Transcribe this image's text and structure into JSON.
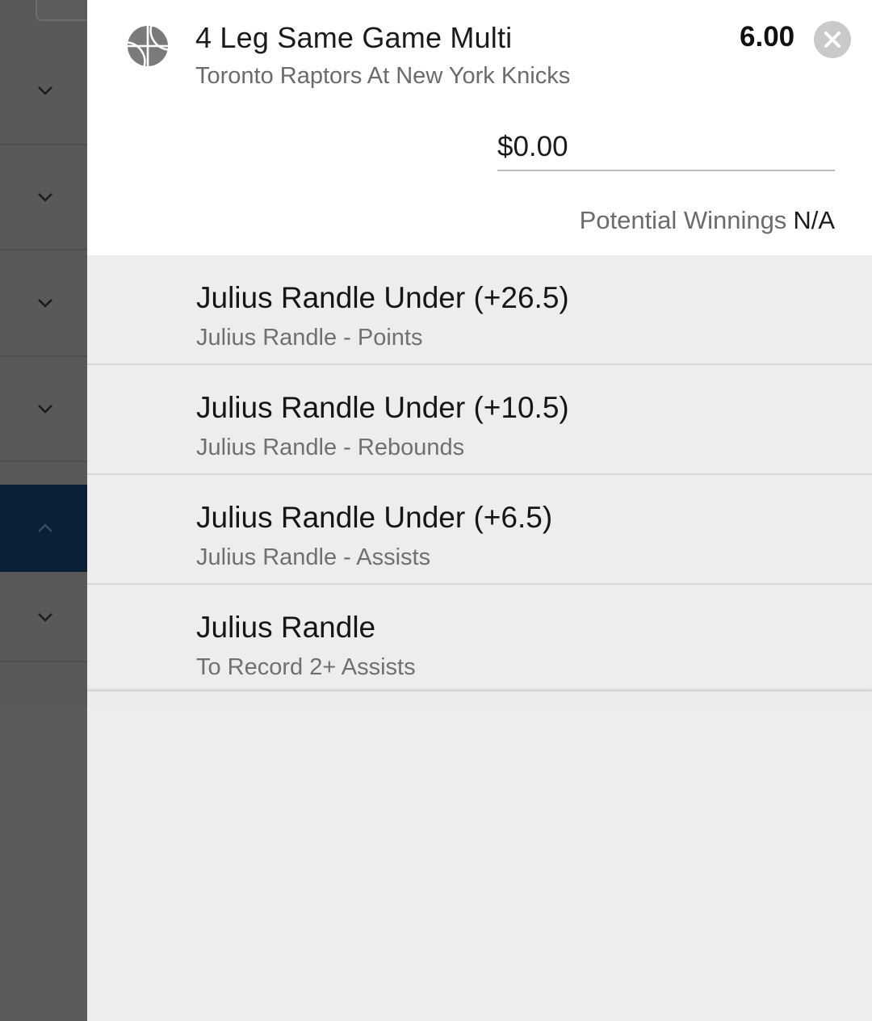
{
  "bet": {
    "title": "4 Leg Same Game Multi",
    "event": "Toronto Raptors At New York Knicks",
    "odds": "6.00",
    "stake": "$0.00",
    "winnings_label": "Potential Winnings",
    "winnings_value": "N/A"
  },
  "legs": [
    {
      "title": "Julius Randle Under (+26.5)",
      "market": "Julius Randle - Points"
    },
    {
      "title": "Julius Randle Under (+10.5)",
      "market": "Julius Randle - Rebounds"
    },
    {
      "title": "Julius Randle Under (+6.5)",
      "market": "Julius Randle - Assists"
    },
    {
      "title": "Julius Randle",
      "market": "To Record 2+ Assists"
    }
  ],
  "icons": {
    "sport": "basketball-icon",
    "close": "close-icon",
    "expand": "chevron-down-icon",
    "collapse": "chevron-up-icon"
  },
  "colors": {
    "active_row": "#0a2036",
    "leg_background": "#ededee"
  }
}
